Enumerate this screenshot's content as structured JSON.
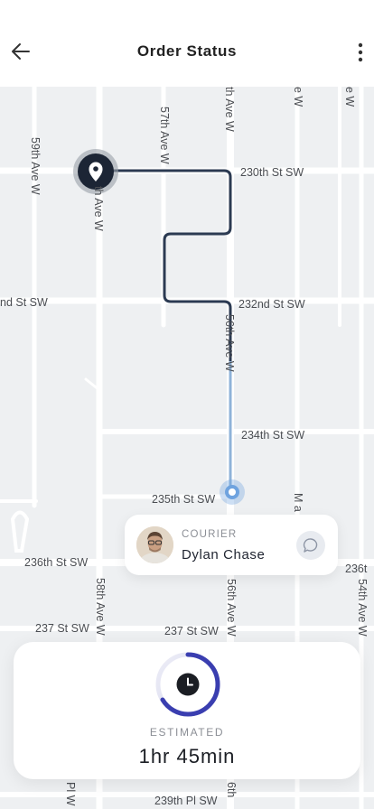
{
  "header": {
    "title": "Order Status",
    "back_icon": "arrow-left-icon",
    "menu_icon": "more-vertical-icon"
  },
  "map": {
    "streets": {
      "s230": "230th St SW",
      "s232a": "nd St SW",
      "s232b": "232nd St SW",
      "s234": "234th St SW",
      "s235": "235th St SW",
      "s236a": "236th St SW",
      "s236b": "236t",
      "s237a": "237 St SW",
      "s237b": "237 St SW",
      "s239": "239th Pl SW",
      "a59": "59th Ave W",
      "a58top": "th Ave W",
      "a57": "57th Ave W",
      "a56top": "th Ave W",
      "a56mid": "56th Ave W",
      "a56bot": "56th Ave W",
      "a58bot": "58th Ave W",
      "a54": "54th Ave W",
      "a56last": "6th",
      "ma": "M a",
      "pl": "Pl W",
      "topa": "e W",
      "topb": "e W"
    },
    "route_color": "#2b3a52",
    "route_fade_color": "#8eb2d8",
    "pin_icon": "location-pin-icon",
    "courier_dot_color": "#6fa3df"
  },
  "courier": {
    "role": "COURIER",
    "name": "Dylan Chase",
    "chat_icon": "chat-bubble-icon"
  },
  "eta": {
    "label": "ESTIMATED",
    "value": "1hr 45min",
    "icon": "clock-icon",
    "ring_color": "#3a3eb0"
  }
}
